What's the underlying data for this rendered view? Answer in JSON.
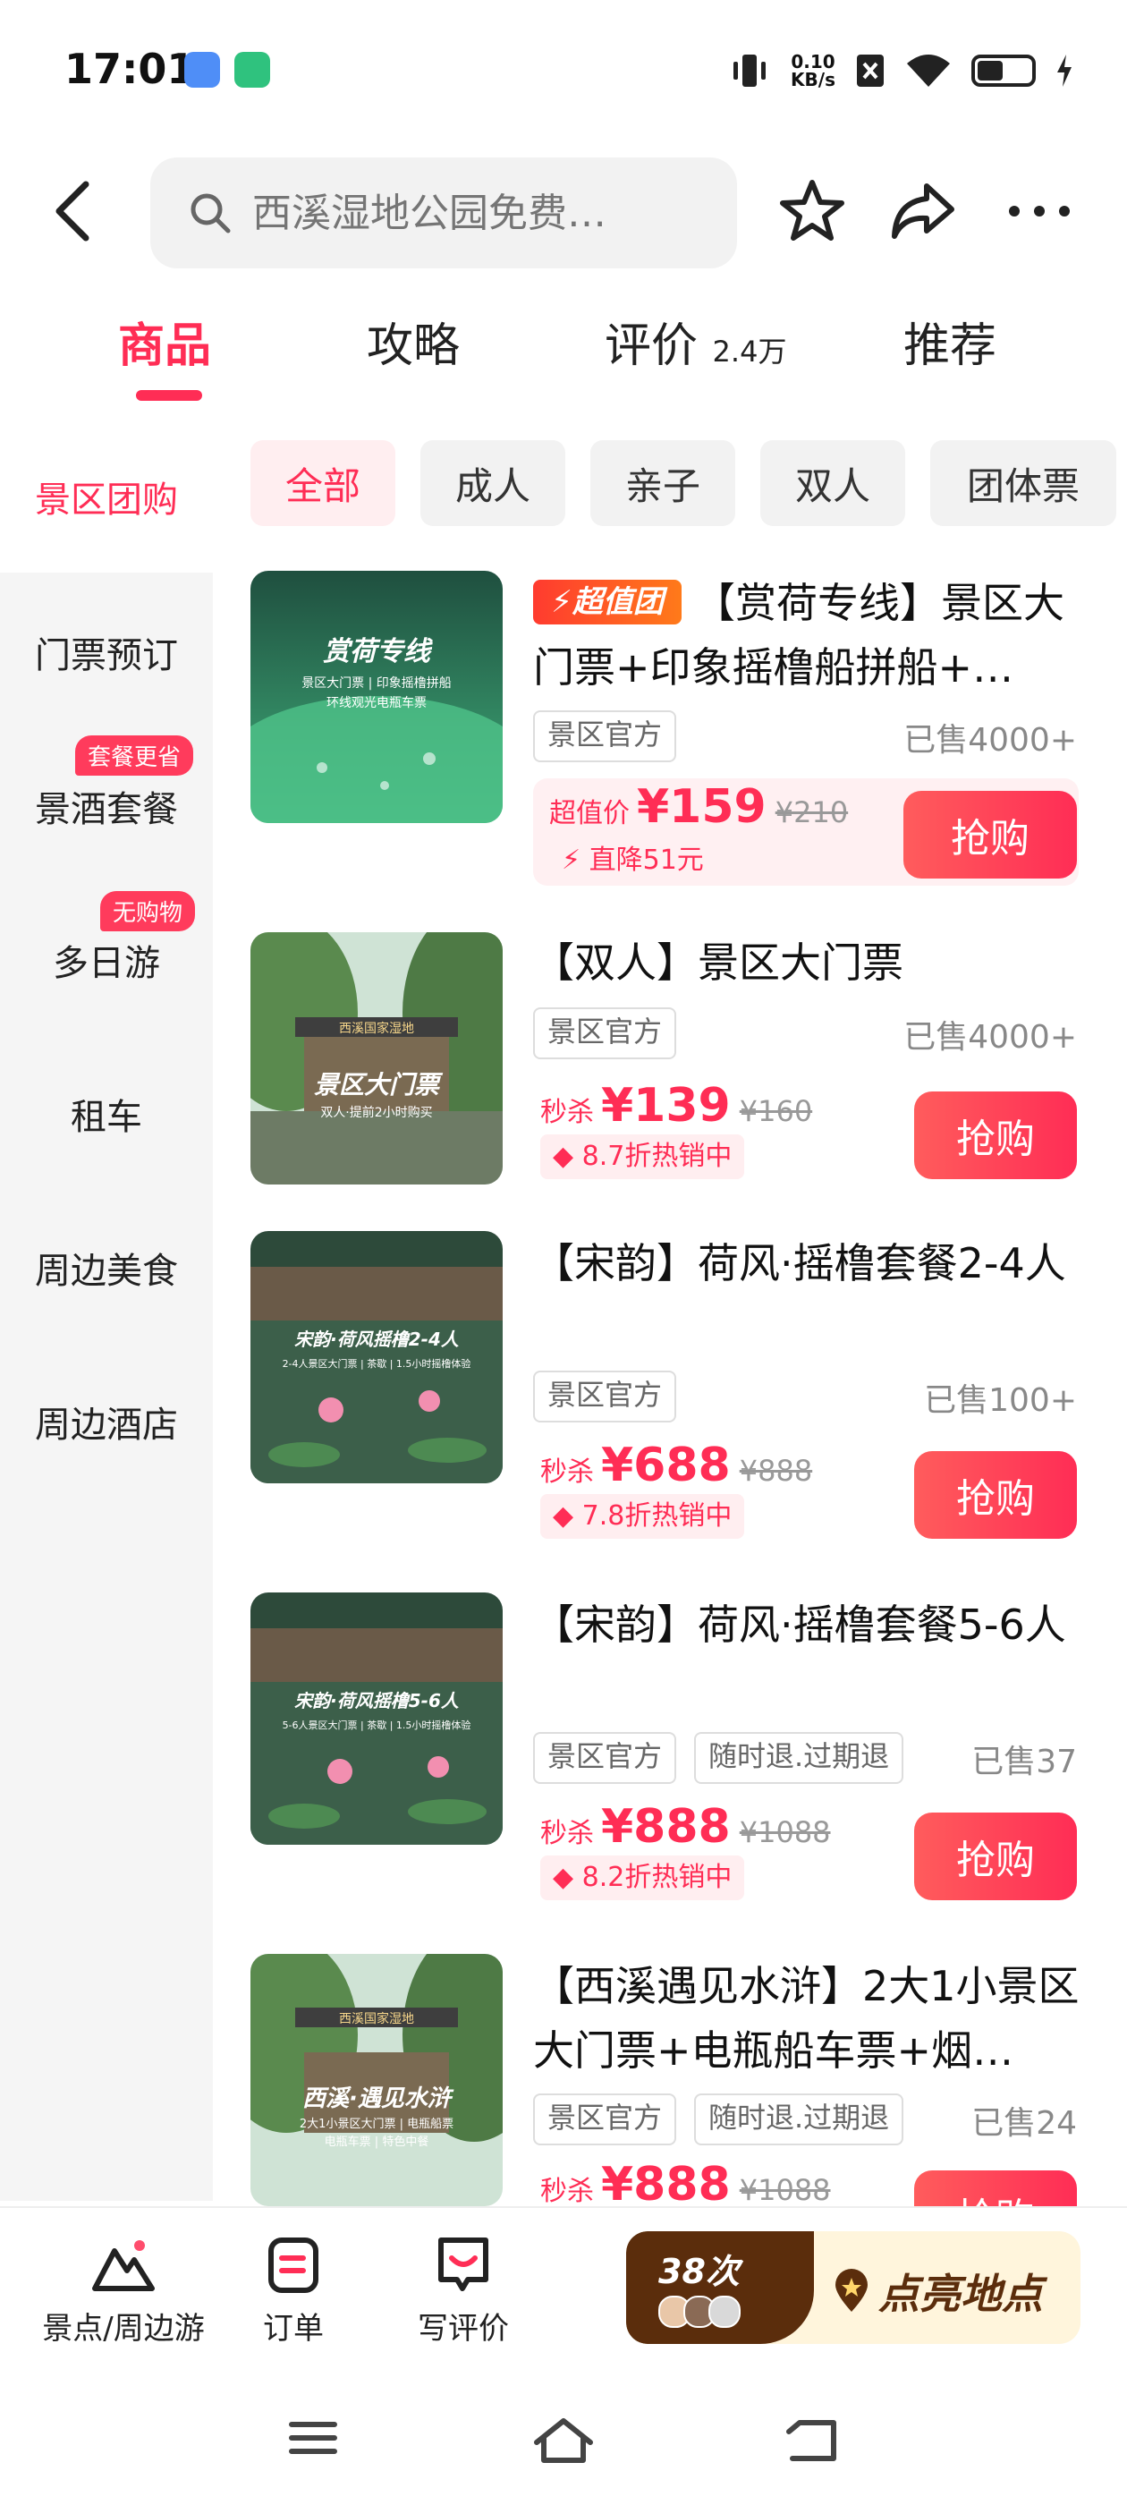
{
  "status_bar": {
    "time": "17:01",
    "net_speed_value": "0.10",
    "net_speed_unit": "KB/s"
  },
  "header": {
    "search_placeholder": "西溪湿地公园免费…",
    "icons": [
      "back-icon",
      "star-icon",
      "share-icon",
      "more-icon"
    ]
  },
  "tabs": [
    {
      "label": "商品",
      "count": ""
    },
    {
      "label": "攻略",
      "count": ""
    },
    {
      "label": "评价",
      "count": "2.4万"
    },
    {
      "label": "推荐",
      "count": ""
    }
  ],
  "sidebar": [
    {
      "label": "景区团购",
      "badge": ""
    },
    {
      "label": "门票预订",
      "badge": ""
    },
    {
      "label": "景酒套餐",
      "badge": "套餐更省"
    },
    {
      "label": "多日游",
      "badge": "无购物"
    },
    {
      "label": "租车",
      "badge": ""
    },
    {
      "label": "周边美食",
      "badge": ""
    },
    {
      "label": "周边酒店",
      "badge": ""
    }
  ],
  "filters": [
    "全部",
    "成人",
    "亲子",
    "双人",
    "团体票"
  ],
  "products": [
    {
      "badge": "超值团",
      "title": "【赏荷专线】景区大门票+印象摇橹船拼船+…",
      "tags": [
        "景区官方"
      ],
      "sold": "已售4000+",
      "price_label": "超值价",
      "price": "¥159",
      "old_price": "¥210",
      "discount": "直降51元",
      "button": "抢购",
      "thumb_title": "赏荷专线",
      "thumb_sub1": "景区大门票 | 印象摇橹拼船",
      "thumb_sub2": "环线观光电瓶车票"
    },
    {
      "title": "【双人】景区大门票",
      "tags": [
        "景区官方"
      ],
      "sold": "已售4000+",
      "price_label": "秒杀",
      "price": "¥139",
      "old_price": "¥160",
      "discount": "8.7折热销中",
      "button": "抢购",
      "thumb_title": "景区大门票",
      "thumb_sub1": "双人·提前2小时购买",
      "thumb_gate": "西溪国家湿地"
    },
    {
      "title": "【宋韵】荷风·摇橹套餐2-4人",
      "tags": [
        "景区官方"
      ],
      "sold": "已售100+",
      "price_label": "秒杀",
      "price": "¥688",
      "old_price": "¥888",
      "discount": "7.8折热销中",
      "button": "抢购",
      "thumb_title": "宋韵·荷风摇橹2-4人",
      "thumb_sub1": "2-4人景区大门票 | 茶歇 | 1.5小时摇橹体验"
    },
    {
      "title": "【宋韵】荷风·摇橹套餐5-6人",
      "tags": [
        "景区官方",
        "随时退.过期退"
      ],
      "sold": "已售37",
      "price_label": "秒杀",
      "price": "¥888",
      "old_price": "¥1088",
      "discount": "8.2折热销中",
      "button": "抢购",
      "thumb_title": "宋韵·荷风摇橹5-6人",
      "thumb_sub1": "5-6人景区大门票 | 茶歇 | 1.5小时摇橹体验"
    },
    {
      "title": "【西溪遇见水浒】2大1小景区大门票+电瓶船车票+烟…",
      "tags": [
        "景区官方",
        "随时退.过期退"
      ],
      "sold": "已售24",
      "price_label": "秒杀",
      "price": "¥888",
      "old_price": "¥1088",
      "button": "抢购",
      "thumb_title": "西溪·遇见水浒",
      "thumb_sub1": "2大1小景区大门票 | 电瓶船票",
      "thumb_sub2": "电瓶车票 | 特色中餐",
      "thumb_gate": "西溪国家湿地"
    }
  ],
  "bottom_nav": [
    {
      "label": "景点/周边游",
      "icon": "mountain-icon"
    },
    {
      "label": "订单",
      "icon": "order-icon"
    },
    {
      "label": "写评价",
      "icon": "review-icon"
    }
  ],
  "light_up": {
    "count": "38次",
    "label": "点亮地点"
  },
  "colors": {
    "accent": "#ff2d55",
    "badge_orange": "#ff6a00",
    "sidebar_bg": "#f5f5f5"
  }
}
